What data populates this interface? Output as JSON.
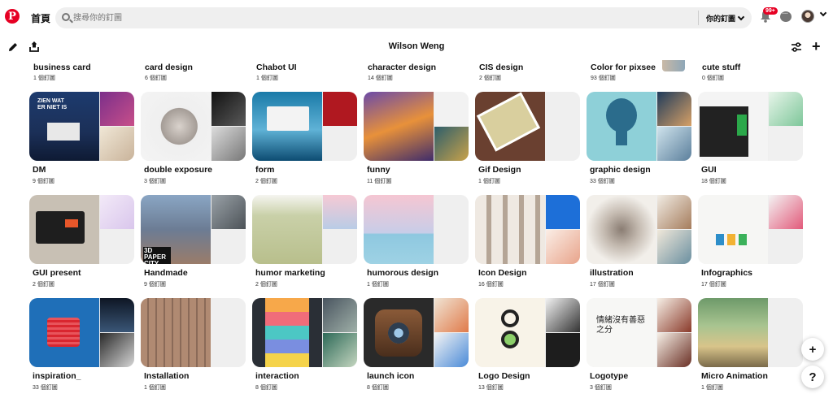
{
  "header": {
    "home_label": "首頁",
    "search_placeholder": "搜尋你的釘圖",
    "your_pins_label": "你的釘圖",
    "notification_badge": "99+"
  },
  "subbar": {
    "title": "Wilson Weng"
  },
  "top_row": [
    {
      "title": "business card",
      "count": "1 個釘圖"
    },
    {
      "title": "card design",
      "count": "6 個釘圖"
    },
    {
      "title": "Chabot UI",
      "count": "1 個釘圖"
    },
    {
      "title": "character design",
      "count": "14 個釘圖"
    },
    {
      "title": "CIS design",
      "count": "2 個釘圖"
    },
    {
      "title": "Color for pixsee",
      "count": "93 個釘圖"
    },
    {
      "title": "cute stuff",
      "count": "0 個釘圖"
    }
  ],
  "boards": [
    {
      "title": "DM",
      "count": "9 個釘圖"
    },
    {
      "title": "double exposure",
      "count": "3 個釘圖"
    },
    {
      "title": "form",
      "count": "2 個釘圖"
    },
    {
      "title": "funny",
      "count": "11 個釘圖"
    },
    {
      "title": "Gif Design",
      "count": "1 個釘圖"
    },
    {
      "title": "graphic design",
      "count": "33 個釘圖"
    },
    {
      "title": "GUI",
      "count": "18 個釘圖"
    },
    {
      "title": "GUI present",
      "count": "2 個釘圖"
    },
    {
      "title": "Handmade",
      "count": "9 個釘圖"
    },
    {
      "title": "humor marketing",
      "count": "2 個釘圖"
    },
    {
      "title": "humorous design",
      "count": "1 個釘圖"
    },
    {
      "title": "Icon Design",
      "count": "16 個釘圖"
    },
    {
      "title": "illustration",
      "count": "17 個釘圖"
    },
    {
      "title": "Infographics",
      "count": "17 個釘圖"
    },
    {
      "title": "inspiration_",
      "count": "33 個釘圖"
    },
    {
      "title": "Installation",
      "count": "1 個釘圖"
    },
    {
      "title": "interaction",
      "count": "8 個釘圖"
    },
    {
      "title": "launch icon",
      "count": "8 個釘圖"
    },
    {
      "title": "Logo Design",
      "count": "13 個釘圖"
    },
    {
      "title": "Logotype",
      "count": "3 個釘圖"
    },
    {
      "title": "Micro Animation",
      "count": "1 個釘圖"
    }
  ],
  "cover_text": {
    "dm": "ZIEN WAT ER NIET IS",
    "handmade": "3D PAPER CITY",
    "logotype": "情緒沒有善惡之分"
  },
  "colors": {
    "brand": "#e60023",
    "search_bg": "#efefef",
    "text": "#111111"
  },
  "fab": {
    "plus": "+",
    "help": "?"
  }
}
